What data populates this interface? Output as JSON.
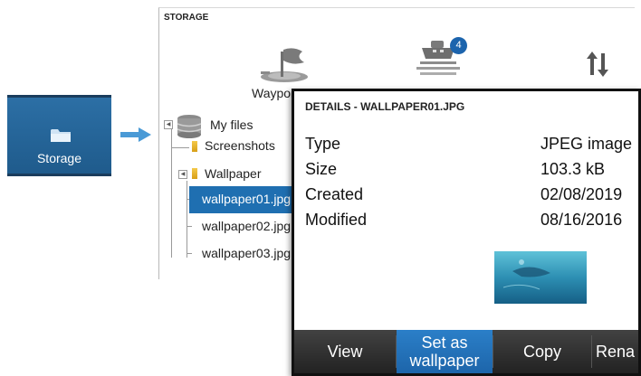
{
  "storage_tile": {
    "label": "Storage",
    "icon": "folder-icon"
  },
  "panel": {
    "title": "STORAGE",
    "tabs": [
      {
        "label": "Waypoi",
        "icon": "waypoint-flag-icon"
      },
      {
        "label": "",
        "icon": "boat-icon",
        "badge": "4"
      },
      {
        "label": "",
        "icon": "transfer-arrows-icon"
      }
    ]
  },
  "tree": {
    "root": "My files",
    "items": [
      "Screenshots",
      "Wallpaper",
      "wallpaper01.jpg",
      "wallpaper02.jpg",
      "wallpaper03.jpg"
    ]
  },
  "details": {
    "title": "DETAILS - WALLPAPER01.JPG",
    "rows": [
      {
        "label": "Type",
        "value": "JPEG image"
      },
      {
        "label": "Size",
        "value": "103.3 kB"
      },
      {
        "label": "Created",
        "value": "02/08/2019"
      },
      {
        "label": "Modified",
        "value": "08/16/2016"
      }
    ],
    "actions": [
      "View",
      "Set as wallpaper",
      "Copy",
      "Rena"
    ]
  },
  "colors": {
    "accent": "#1f6fb1",
    "tile": "#2c6fa5",
    "action_bar": "#2a2a2a"
  }
}
